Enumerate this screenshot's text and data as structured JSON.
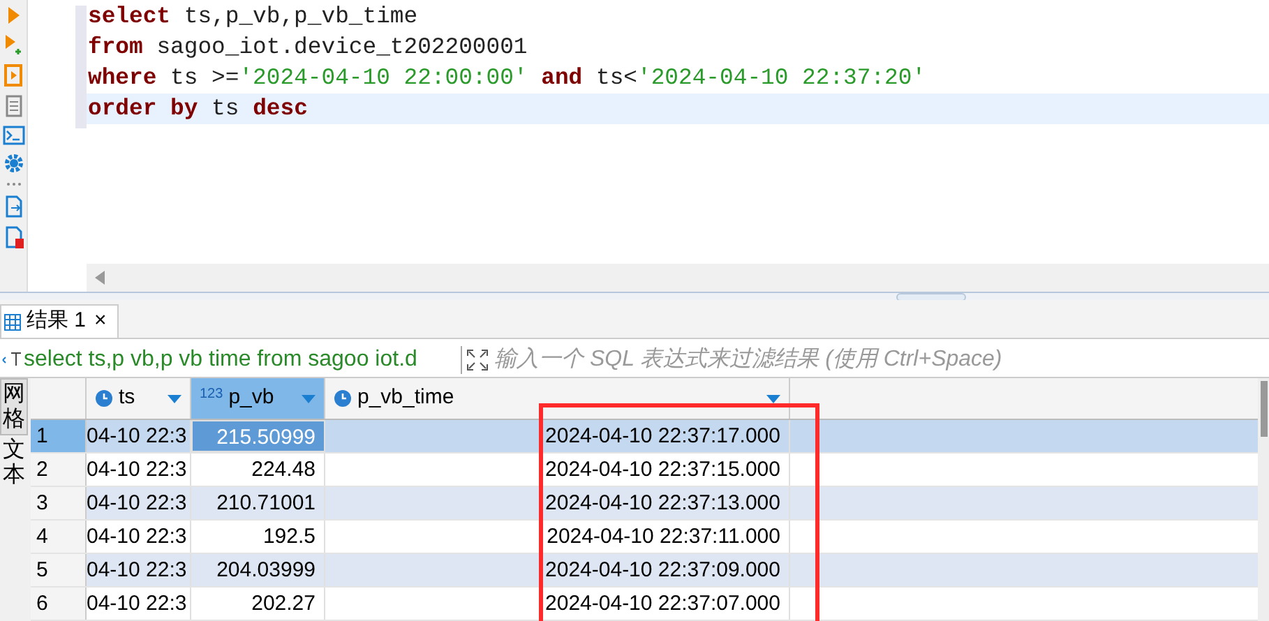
{
  "editor": {
    "lines": [
      {
        "current": false,
        "segments": [
          {
            "kind": "keyword",
            "text": "select"
          },
          {
            "kind": "plain",
            "text": " ts,p_vb,p_vb_time"
          }
        ]
      },
      {
        "current": false,
        "segments": [
          {
            "kind": "keyword",
            "text": "from"
          },
          {
            "kind": "plain",
            "text": " sagoo_iot.device_t202200001"
          }
        ]
      },
      {
        "current": false,
        "segments": [
          {
            "kind": "keyword",
            "text": "where"
          },
          {
            "kind": "plain",
            "text": " ts >="
          },
          {
            "kind": "string",
            "text": "'2024-04-10 22:00:00'"
          },
          {
            "kind": "keyword",
            "text": " and"
          },
          {
            "kind": "plain",
            "text": " ts<"
          },
          {
            "kind": "string",
            "text": "'2024-04-10 22:37:20'"
          }
        ]
      },
      {
        "current": true,
        "segments": [
          {
            "kind": "keyword",
            "text": "order by"
          },
          {
            "kind": "plain",
            "text": " ts "
          },
          {
            "kind": "keyword",
            "text": "desc"
          }
        ]
      }
    ]
  },
  "results_tabs": [
    {
      "label": "结果 1",
      "close": "×",
      "selected": true
    }
  ],
  "filter_bar": {
    "query": "select ts,p vb,p vb time from sagoo iot.d",
    "placeholder": "输入一个 SQL 表达式来过滤结果 (使用 Ctrl+Space)"
  },
  "view_tabs": [
    {
      "label": "网格",
      "selected": true
    },
    {
      "label": "文本",
      "selected": false
    }
  ],
  "table": {
    "columns": [
      {
        "label": "ts",
        "kind": "time",
        "selected": false
      },
      {
        "label": "p_vb",
        "kind": "number",
        "prefix": "123",
        "selected": true
      },
      {
        "label": "p_vb_time",
        "kind": "time",
        "selected": false
      }
    ],
    "rows": [
      {
        "number": "1",
        "cells": [
          "04-10 22:3",
          "215.50999",
          "2024-04-10 22:37:17.000"
        ],
        "selected": true
      },
      {
        "number": "2",
        "cells": [
          "04-10 22:3",
          "224.48",
          "2024-04-10 22:37:15.000"
        ],
        "selected": false
      },
      {
        "number": "3",
        "cells": [
          "04-10 22:3",
          "210.71001",
          "2024-04-10 22:37:13.000"
        ],
        "selected": false
      },
      {
        "number": "4",
        "cells": [
          "04-10 22:3",
          "192.5",
          "2024-04-10 22:37:11.000"
        ],
        "selected": false
      },
      {
        "number": "5",
        "cells": [
          "04-10 22:3",
          "204.03999",
          "2024-04-10 22:37:09.000"
        ],
        "selected": false
      },
      {
        "number": "6",
        "cells": [
          "04-10 22:3",
          "202.27",
          "2024-04-10 22:37:07.000"
        ],
        "selected": false
      }
    ]
  },
  "annotations": [
    {
      "kind": "frame",
      "color": "#ff2a2a"
    }
  ]
}
